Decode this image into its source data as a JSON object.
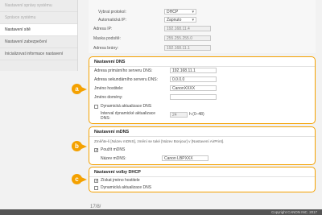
{
  "sidebar": {
    "items": [
      {
        "label": "Nastavení správy systému"
      },
      {
        "label": "Správce systému"
      },
      {
        "label": "Nastavení sítě"
      },
      {
        "label": "Nastavení zabezpečení"
      },
      {
        "label": "Inicializovat informace nastavení"
      }
    ]
  },
  "top": {
    "obtain_label": "Vybrat protokol:",
    "obtain_value": "DHCP",
    "auto_ip_label": "Automatická IP:",
    "auto_ip_value": "Zapnuto",
    "ip_label": "Adresa IP:",
    "ip_value": "192.168.11.4",
    "mask_label": "Maska podsítě:",
    "mask_value": "255.255.255.0",
    "gateway_label": "Adresa brány:",
    "gateway_value": "192.168.11.1"
  },
  "dns": {
    "title": "Nastavení DNS",
    "primary_label": "Adresa primárního serveru DNS:",
    "primary_value": "192.168.11.1",
    "secondary_label": "Adresa sekundárního serveru DNS:",
    "secondary_value": "0.0.0.0",
    "host_label": "Jméno hostitele:",
    "host_value": "CanonXXXX",
    "domain_label": "Jméno domény:",
    "domain_value": "",
    "dynamic_label": "Dynamická aktualizace DNS",
    "interval_label": "Interval dynamické aktualizace DNS:",
    "interval_value": "24",
    "interval_unit": "h (0–48)"
  },
  "mdns": {
    "title": "Nastavení mDNS",
    "note": "Změňte-li [Název mDNS], změní se také [Název Bonjour] v [Nastavení AirPrint].",
    "use_label": "Použít mDNS",
    "name_label": "Název mDNS:",
    "name_value": "Canon LBPXXX"
  },
  "dhcp": {
    "title": "Nastavení volby DHCP",
    "hostname_label": "Získat jméno hostitele",
    "dynamic_label": "Dynamická aktualizace DNS"
  },
  "badges": {
    "a": "a",
    "b": "b",
    "c": "c"
  },
  "footer": {
    "copyright": "Copyright CANON INC. 2017"
  },
  "timestamp": "17/8/"
}
